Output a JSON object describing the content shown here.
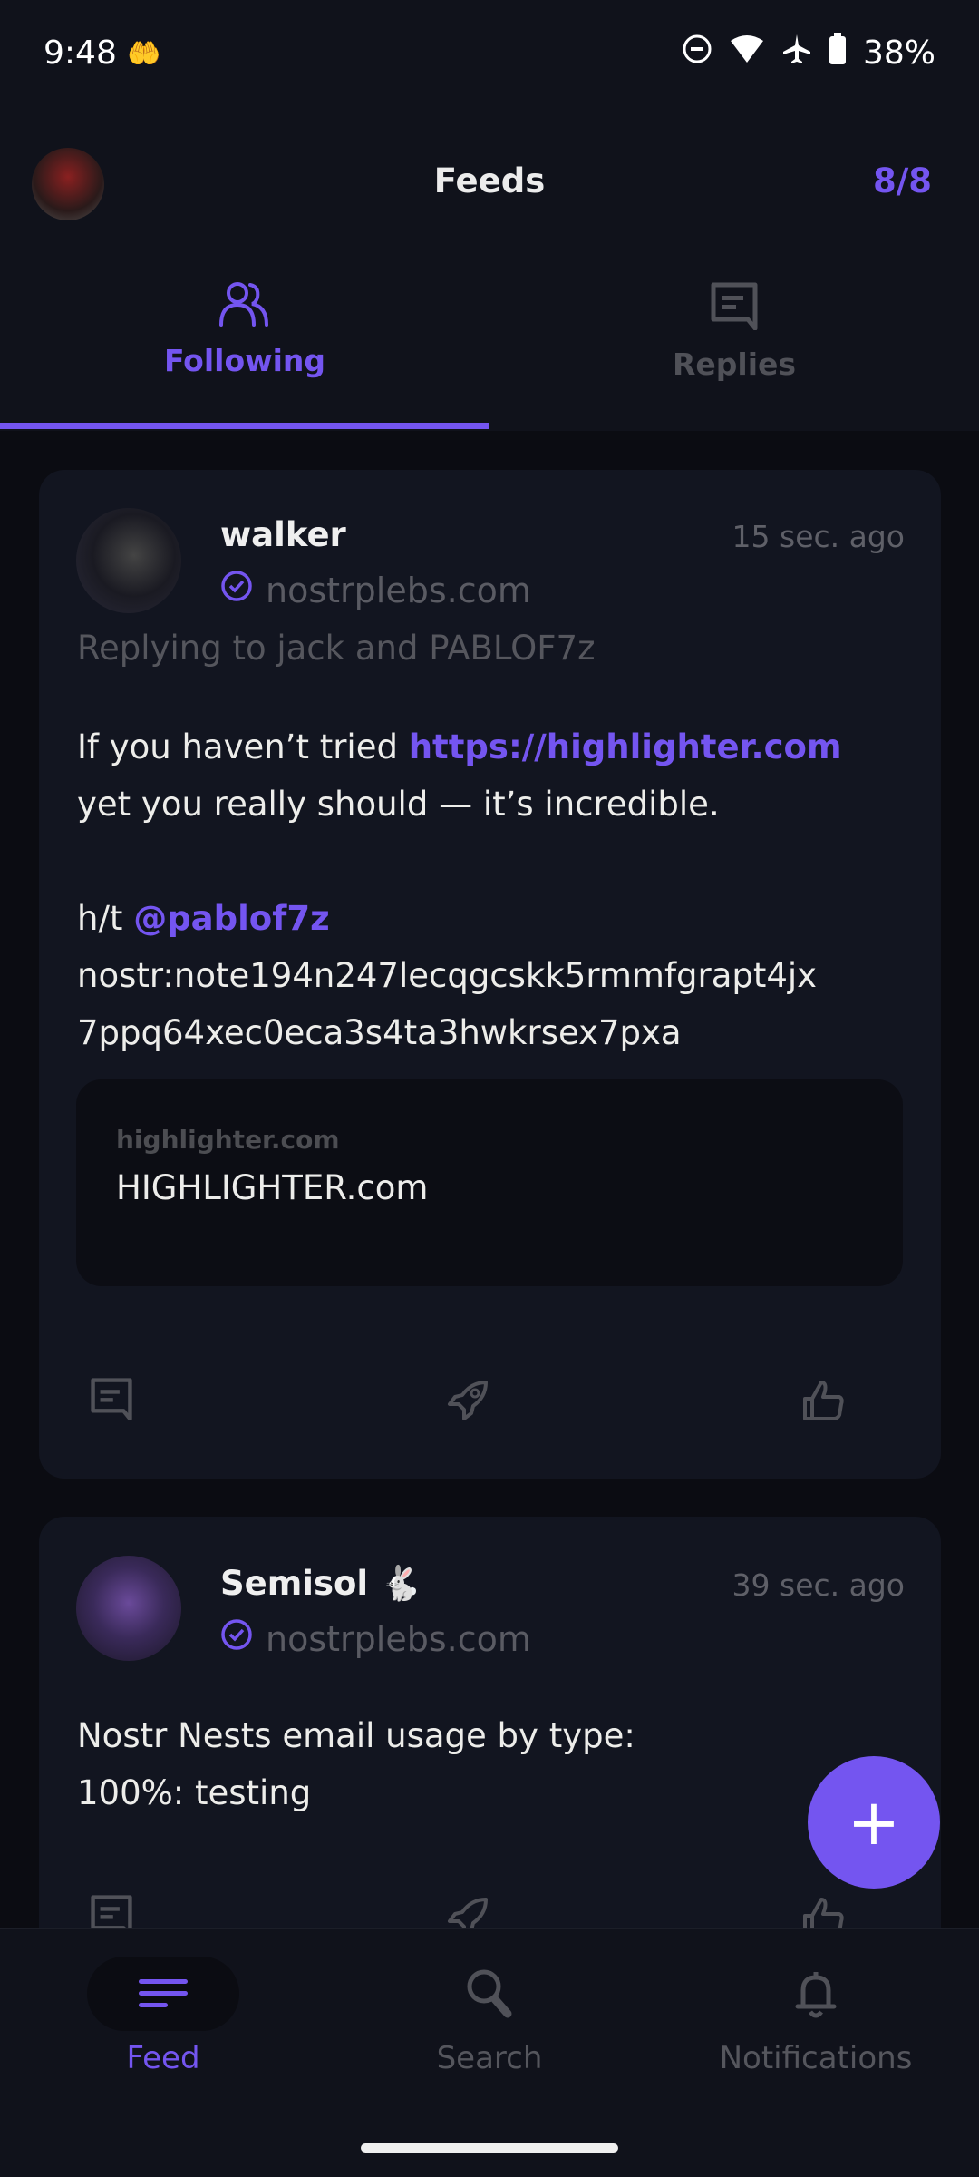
{
  "status_bar": {
    "time": "9:48",
    "battery": "38%",
    "icons": [
      "hand-coin-icon",
      "dnd-icon",
      "wifi-icon",
      "airplane-icon",
      "battery-icon"
    ]
  },
  "header": {
    "title": "Feeds",
    "relay_count": "8/8"
  },
  "tabs": [
    {
      "label": "Following",
      "icon": "people-icon",
      "active": true
    },
    {
      "label": "Replies",
      "icon": "message-icon",
      "active": false
    }
  ],
  "posts": [
    {
      "author": "walker",
      "time": "15 sec. ago",
      "nip05": "nostrplebs.com",
      "replying_to": "Replying to jack and PABLOF7z",
      "body": {
        "line1_text": "If you haven’t tried ",
        "line1_link": "https://highlighter.com",
        "line2": "yet you really should — it’s incredible.",
        "ht_text": "h/t ",
        "ht_mention": "@pablof7z",
        "note_line1": "nostr:note194n247lecqgcskk5rmmfgrapt4jx",
        "note_line2": "7ppq64xec0eca3s4ta3hwkrsex7pxa"
      },
      "preview": {
        "domain": "highlighter.com",
        "title": "HIGHLIGHTER.com"
      }
    },
    {
      "author": "Semisol 🐇",
      "time": "39 sec. ago",
      "nip05": "nostrplebs.com",
      "body": {
        "line1": "Nostr Nests email usage by type:",
        "line2": "100%: testing"
      }
    }
  ],
  "fab": {
    "label": "+"
  },
  "bottom_nav": [
    {
      "label": "Feed",
      "icon": "feed-icon",
      "active": true
    },
    {
      "label": "Search",
      "icon": "search-icon",
      "active": false
    },
    {
      "label": "Notifications",
      "icon": "bell-icon",
      "active": false
    }
  ],
  "colors": {
    "accent": "#7455f0",
    "background": "#10121b",
    "card": "#121520",
    "muted": "#5f6068"
  }
}
